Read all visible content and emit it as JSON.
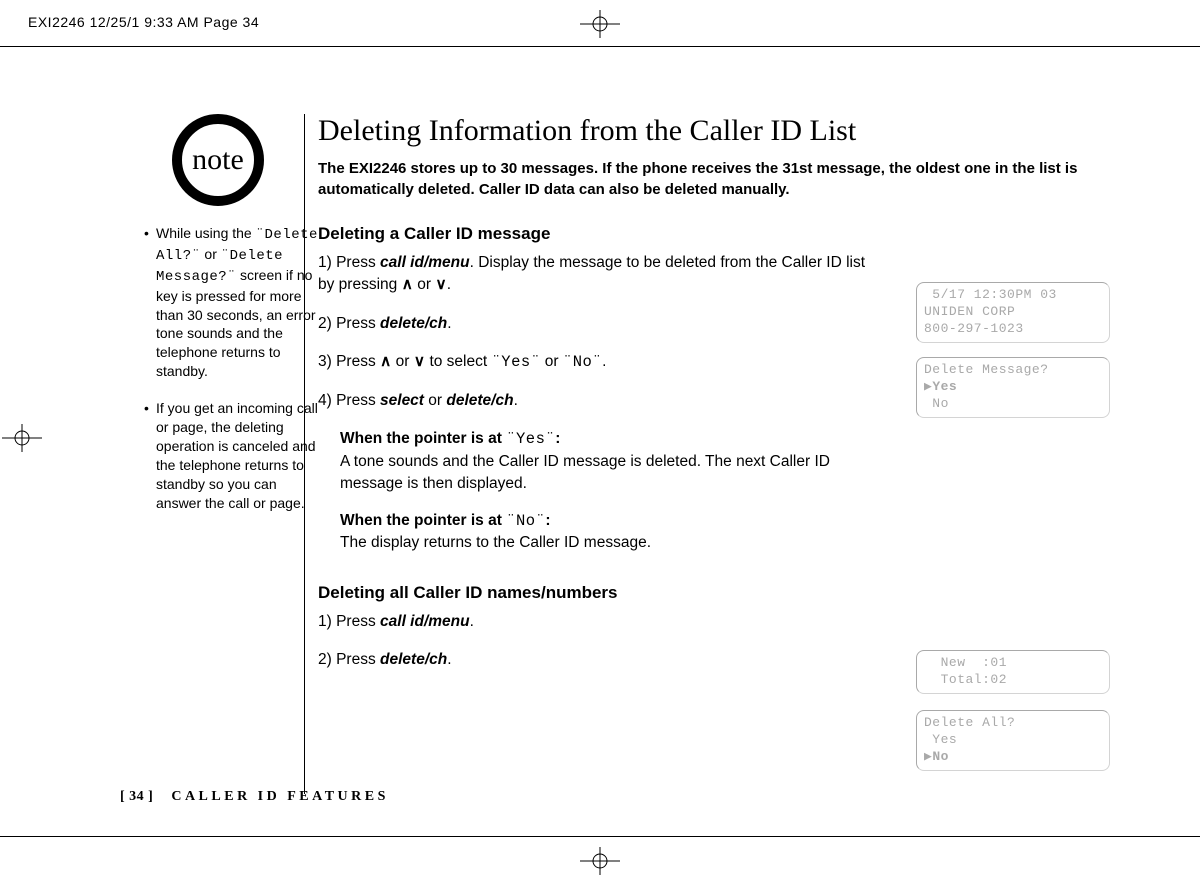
{
  "slug": "EXI2246  12/25/1 9:33 AM  Page 34",
  "sidebar": {
    "note_label": "note",
    "item1_prefix": "While using the ",
    "item1_mono1": "¨Delete All?¨",
    "item1_mid": " or ",
    "item1_mono2": "¨Delete Message?¨",
    "item1_rest": " screen if no key is pressed for more than 30 seconds, an error tone sounds and the telephone returns to standby.",
    "item2": "If you get an incoming call or page, the deleting operation is canceled and the telephone returns to standby so you can answer the call or page."
  },
  "main": {
    "title": "Deleting Information from the Caller ID List",
    "lead": "The EXI2246 stores up to 30 messages. If the phone receives the 31st message, the oldest one in the list is automatically deleted. Caller ID data can also be deleted manually.",
    "sub1": "Deleting a Caller ID message",
    "step1_a": "1) Press ",
    "key_callidmenu": "call id/menu",
    "step1_b": ". Display the message to be deleted from the Caller ID list by pressing ",
    "up": "∧",
    "or": " or ",
    "down": "∨",
    "step1_c": ".",
    "step2_a": "2) Press ",
    "key_delete": "delete/ch",
    "step2_b": ".",
    "step3_a": "3) Press ",
    "step3_b": " to select ",
    "yes_mono": "¨Yes¨",
    "no_mono": "¨No¨",
    "step3_c": ".",
    "step4_a": "4) Press ",
    "key_select": "select",
    "step4_b": " or ",
    "step4_c": ".",
    "when_yes_label": "When the pointer is at ",
    "colon": ":",
    "when_yes_body": "A tone sounds and the Caller ID message is deleted. The next Caller ID message is then displayed.",
    "when_no_body": "The display returns to the Caller ID message.",
    "sub2": "Deleting all Caller ID names/numbers",
    "steps2_1_a": "1) Press ",
    "steps2_1_b": ".",
    "steps2_2_a": "2) Press ",
    "steps2_2_b": "."
  },
  "lcds": {
    "cid": {
      "l1": " 5/17 12:30PM 03",
      "l2": "UNIDEN CORP",
      "l3": "800-297-1023"
    },
    "delmsg": {
      "l1": "Delete Message?",
      "l2": "▶Yes",
      "l3": " No"
    },
    "totals": {
      "l1": "  New  :01",
      "l2": "  Total:02"
    },
    "delall": {
      "l1": "Delete All?",
      "l2": " Yes",
      "l3": "▶No"
    }
  },
  "footer": {
    "page": "[ 34 ]",
    "section": "CALLER ID FEATURES"
  }
}
